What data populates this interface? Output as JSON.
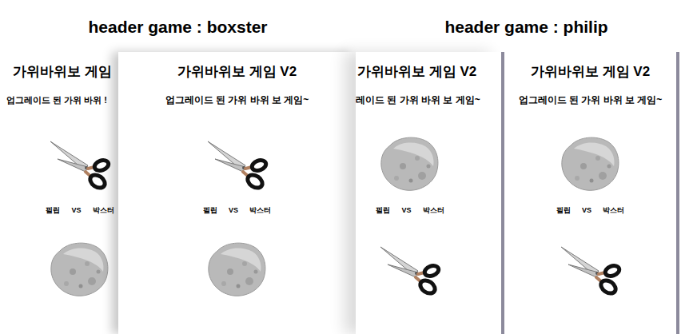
{
  "sections": [
    {
      "title": "header game : boxster",
      "screens": [
        {
          "title": "가위바위보 게임",
          "subtitle": "업그레이드 된 가위 바위 !",
          "player": "필립",
          "vs": "VS",
          "opponent": "박스터",
          "hands": [
            {
              "kind": "scissors"
            },
            {
              "kind": "rock"
            }
          ]
        },
        {
          "title": "가위바위보 게임 V2",
          "subtitle": "업그레이드 된 가위 바위 보 게임~",
          "player": "필립",
          "vs": "VS",
          "opponent": "박스터",
          "hands": [
            {
              "kind": "scissors"
            },
            {
              "kind": "rock"
            }
          ]
        }
      ]
    },
    {
      "title": "header game : philip",
      "screens": [
        {
          "title": "가위바위보 게임 V2",
          "subtitle": "레이드 된 가위 바위 보 게임~",
          "player": "필립",
          "vs": "VS",
          "opponent": "박스터",
          "hands": [
            {
              "kind": "rock"
            },
            {
              "kind": "scissors"
            }
          ]
        },
        {
          "title": "가위바위보 게임 V2",
          "subtitle": "업그레이드 된 가위 바위 보 게임~",
          "player": "필립",
          "vs": "VS",
          "opponent": "박스터",
          "hands": [
            {
              "kind": "rock"
            },
            {
              "kind": "scissors"
            }
          ]
        }
      ]
    }
  ]
}
